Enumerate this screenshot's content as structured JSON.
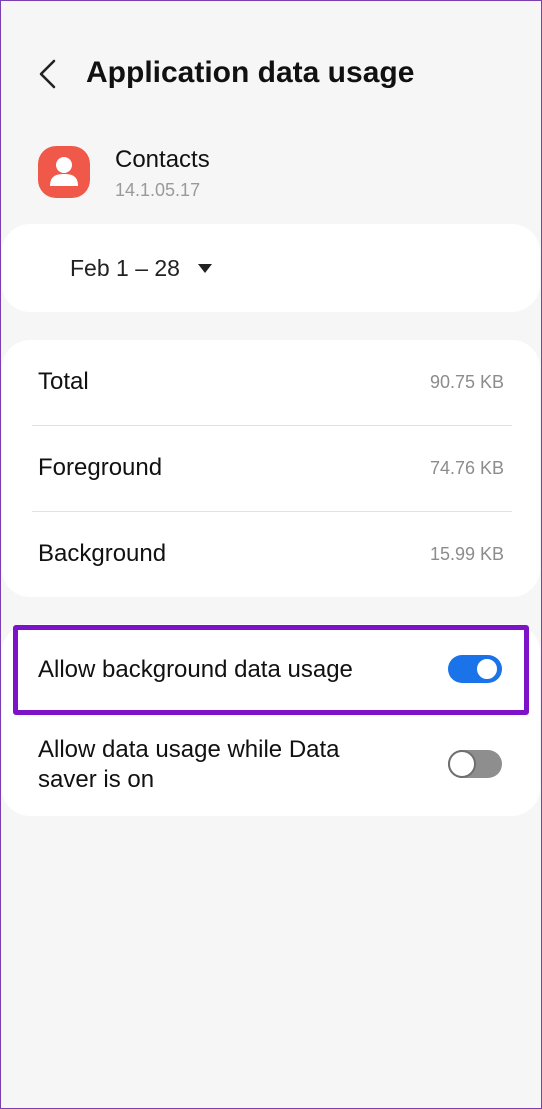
{
  "header": {
    "title": "Application data usage",
    "back_icon": "chevron-left-icon"
  },
  "app": {
    "name": "Contacts",
    "version": "14.1.05.17",
    "icon": "contacts-person-icon",
    "icon_color": "#f0584a"
  },
  "date_range": {
    "label": "Feb 1 – 28",
    "icon": "dropdown-triangle-icon"
  },
  "usage": {
    "rows": [
      {
        "label": "Total",
        "value": "90.75 KB"
      },
      {
        "label": "Foreground",
        "value": "74.76 KB"
      },
      {
        "label": "Background",
        "value": "15.99 KB"
      }
    ]
  },
  "toggles": [
    {
      "label": "Allow background data usage",
      "state": "on"
    },
    {
      "label": "Allow data usage while Data saver is on",
      "state": "off"
    }
  ],
  "colors": {
    "accent": "#1a73e8",
    "highlight": "#7d12c9",
    "background": "#f6f6f6"
  }
}
